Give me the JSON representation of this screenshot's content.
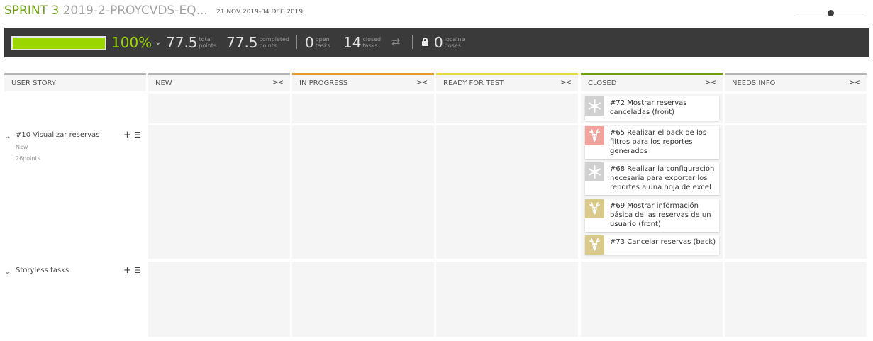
{
  "header": {
    "sprint_label": "SPRINT 3",
    "project_name": "2019-2-PROYCVDS-EQ...",
    "dates": "21 NOV 2019-04 DEC 2019",
    "zoom_level": 0.47
  },
  "stats": {
    "progress": 1.0,
    "percent": "100%",
    "total_points": {
      "value": "77.5",
      "label_1": "total",
      "label_2": "points"
    },
    "completed_points": {
      "value": "77.5",
      "label_1": "completed",
      "label_2": "points"
    },
    "open_tasks": {
      "value": "0",
      "label_1": "open",
      "label_2": "tasks"
    },
    "closed_tasks": {
      "value": "14",
      "label_1": "closed",
      "label_2": "tasks"
    },
    "iocaine": {
      "value": "0",
      "label_1": "iocaine",
      "label_2": "doses"
    }
  },
  "columns": [
    {
      "label": "USER STORY",
      "color": "#b5b5b5"
    },
    {
      "label": "NEW",
      "color": "#b5b5b5"
    },
    {
      "label": "IN PROGRESS",
      "color": "#e49b27"
    },
    {
      "label": "READY FOR TEST",
      "color": "#e8d83b"
    },
    {
      "label": "CLOSED",
      "color": "#6e9f10"
    },
    {
      "label": "NEEDS INFO",
      "color": "#b5b5b5"
    }
  ],
  "stories": [
    {
      "title": "#10 Visualizar reservas",
      "status": "New",
      "points": "26points"
    },
    {
      "title": "Storyless tasks"
    }
  ],
  "cards": [
    {
      "text": "#72 Mostrar reservas canceladas (front)",
      "avatar_color": "#d0d0d0",
      "avatar_icon": "snowflake-icon"
    },
    {
      "text": "#65 Realizar el back de los filtros para los reportes generados",
      "avatar_color": "#f0a39d",
      "avatar_icon": "deer-icon"
    },
    {
      "text": "#68 Realizar la configuración necesaria para exportar los reportes a una hoja de excel",
      "avatar_color": "#d0d0d0",
      "avatar_icon": "snowflake-icon"
    },
    {
      "text": "#69 Mostrar información básica de las reservas de un usuario (front)",
      "avatar_color": "#d9c98b",
      "avatar_icon": "deer-icon"
    },
    {
      "text": "#73 Cancelar reservas (back)",
      "avatar_color": "#d9c98b",
      "avatar_icon": "deer-icon"
    }
  ]
}
